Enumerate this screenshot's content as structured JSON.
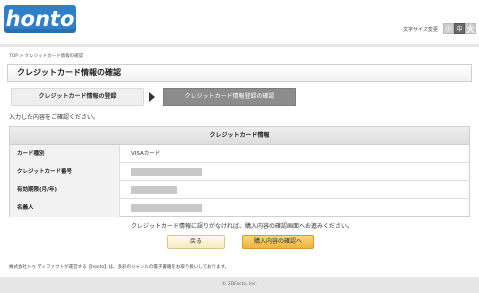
{
  "header": {
    "logo_text": "honto",
    "font_size_label": "文字サイズ変更",
    "font_sizes": [
      "小",
      "中",
      "大"
    ]
  },
  "breadcrumb": "TOP > クレジットカード情報の確認",
  "page_title": "クレジットカード情報の確認",
  "steps": {
    "step1": "クレジットカード情報の登録",
    "step2": "クレジットカード情報登録の確認"
  },
  "instruction": "入力した内容をご確認ください。",
  "table": {
    "header": "クレジットカード情報",
    "rows": [
      {
        "label": "カード種別",
        "value": "VISAカード"
      },
      {
        "label": "クレジットカード番号",
        "value": ""
      },
      {
        "label": "有効期限(月/年)",
        "value": ""
      },
      {
        "label": "名義人",
        "value": ""
      }
    ]
  },
  "confirm_message": "クレジットカード情報に誤りがなければ、購入内容の確認画面へお進みください。",
  "buttons": {
    "back": "戻る",
    "next": "購入内容の確認へ"
  },
  "footer_note": "株式会社トゥ ディファクトが運営する【honto】は、多彩のジャンルの電子書籍をお取り扱いしております。",
  "copyright": "© 2DFacto, Inc.",
  "colors": {
    "brand": "#2f7fc9",
    "active_step": "#8c8c8c",
    "next_button": "#efb33d"
  }
}
